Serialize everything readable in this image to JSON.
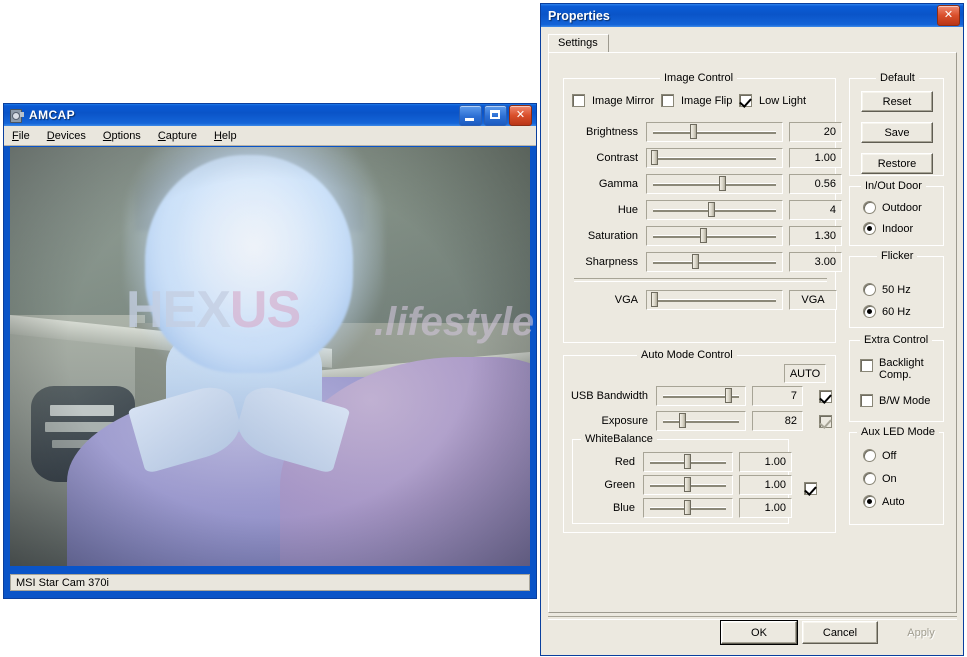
{
  "amcap": {
    "title": "AMCAP",
    "icon": "camera-icon",
    "window_buttons": [
      {
        "name": "minimize-button",
        "glyph": "_"
      },
      {
        "name": "maximize-button",
        "glyph": "□"
      },
      {
        "name": "close-button",
        "glyph": "✕"
      }
    ],
    "menu": [
      {
        "mnemonic": "F",
        "rest": "ile"
      },
      {
        "mnemonic": "D",
        "rest": "evices"
      },
      {
        "mnemonic": "O",
        "rest": "ptions"
      },
      {
        "mnemonic": "C",
        "rest": "apture"
      },
      {
        "mnemonic": "H",
        "rest": "elp"
      }
    ],
    "status": "MSI Star Cam 370i",
    "watermark": {
      "part1": "HEX",
      "part2": "US",
      "suffix": ".lifestyle"
    }
  },
  "properties": {
    "title": "Properties",
    "close_glyph": "✕",
    "tab": "Settings",
    "image_control": {
      "caption": "Image Control",
      "checkboxes": [
        {
          "label": "Image Mirror",
          "checked": false,
          "enabled": true
        },
        {
          "label": "Image Flip",
          "checked": false,
          "enabled": true
        },
        {
          "label": "Low Light",
          "checked": true,
          "enabled": true
        }
      ],
      "sliders": [
        {
          "label": "Brightness",
          "value": "20",
          "pos": 35
        },
        {
          "label": "Contrast",
          "value": "1.00",
          "pos": 4
        },
        {
          "label": "Gamma",
          "value": "0.56",
          "pos": 56
        },
        {
          "label": "Hue",
          "value": "4",
          "pos": 48
        },
        {
          "label": "Saturation",
          "value": "1.30",
          "pos": 42
        },
        {
          "label": "Sharpness",
          "value": "3.00",
          "pos": 36
        }
      ],
      "resolution": {
        "label": "VGA",
        "value": "VGA",
        "pos": 4
      }
    },
    "auto_mode_control": {
      "caption": "Auto Mode Control",
      "auto_label": "AUTO",
      "sliders": [
        {
          "label": "USB Bandwidth",
          "value": "7",
          "pos": 85,
          "auto": true,
          "auto_enabled": true
        },
        {
          "label": "Exposure",
          "value": "82",
          "pos": 28,
          "auto": true,
          "auto_enabled": false
        }
      ],
      "white_balance": {
        "caption": "WhiteBalance",
        "auto": true,
        "channels": [
          {
            "label": "Red",
            "value": "1.00",
            "pos": 50
          },
          {
            "label": "Green",
            "value": "1.00",
            "pos": 50
          },
          {
            "label": "Blue",
            "value": "1.00",
            "pos": 50
          }
        ]
      }
    },
    "default_group": {
      "caption": "Default",
      "buttons": [
        "Reset",
        "Save",
        "Restore"
      ]
    },
    "indoor_group": {
      "caption": "In/Out Door",
      "options": [
        {
          "label": "Outdoor",
          "selected": false
        },
        {
          "label": "Indoor",
          "selected": true
        }
      ]
    },
    "flicker_group": {
      "caption": "Flicker",
      "options": [
        {
          "label": "50 Hz",
          "selected": false
        },
        {
          "label": "60 Hz",
          "selected": true
        }
      ]
    },
    "extra_group": {
      "caption": "Extra Control",
      "checkboxes": [
        {
          "label": "Backlight Comp.",
          "checked": false
        },
        {
          "label": "B/W Mode",
          "checked": false
        }
      ]
    },
    "aux_led_group": {
      "caption": "Aux LED Mode",
      "options": [
        {
          "label": "Off",
          "selected": false
        },
        {
          "label": "On",
          "selected": false
        },
        {
          "label": "Auto",
          "selected": true
        }
      ]
    },
    "dialog_buttons": [
      {
        "label": "OK",
        "enabled": true,
        "focused": true
      },
      {
        "label": "Cancel",
        "enabled": true,
        "focused": false
      },
      {
        "label": "Apply",
        "enabled": false,
        "focused": false
      }
    ]
  },
  "colors": {
    "titlebar_blue": "#0a54c8",
    "dialog_face": "#ece9e0",
    "close_red": "#d94f2b"
  }
}
